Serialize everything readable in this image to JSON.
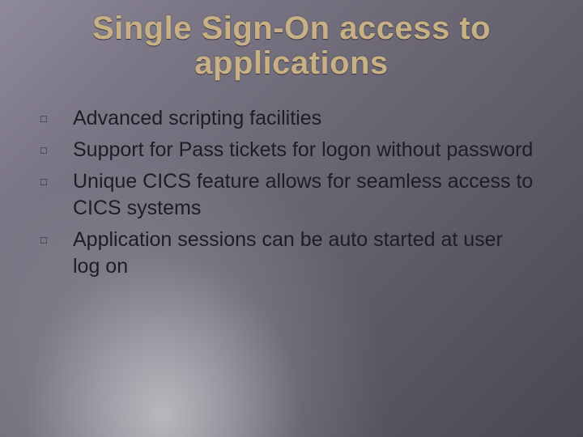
{
  "title_line1": "Single Sign-On access to",
  "title_line2": "applications",
  "bullets": [
    "Advanced scripting facilities",
    "Support for Pass tickets for logon without password",
    "Unique CICS feature allows for seamless access to CICS systems",
    "Application sessions can be auto started at user log on"
  ],
  "bullet_glyph": "□"
}
